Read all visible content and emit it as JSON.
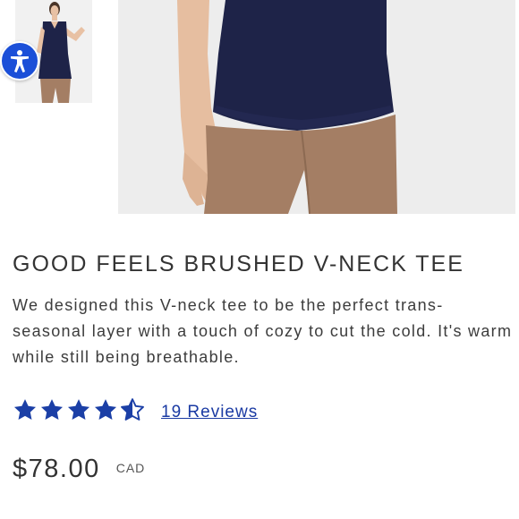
{
  "product": {
    "title": "GOOD FEELS BRUSHED V-NECK TEE",
    "description": "We designed this V-neck tee to be the perfect trans-seasonal layer with a touch of cozy to cut the cold. It's warm while still being breathable.",
    "rating": {
      "value": 4.5,
      "max": 5,
      "reviews_label": "19 Reviews"
    },
    "price": "$78.00",
    "currency": "CAD"
  },
  "colors": {
    "star": "#1b3fa6",
    "link": "#1a3aa3",
    "accessibility_button": "#1b4fd8",
    "top_color": "#1e2348",
    "pants_color": "#a47e64"
  },
  "icons": {
    "accessibility": "accessibility-person-icon",
    "star": "star-icon",
    "half_star": "star-half-icon"
  }
}
